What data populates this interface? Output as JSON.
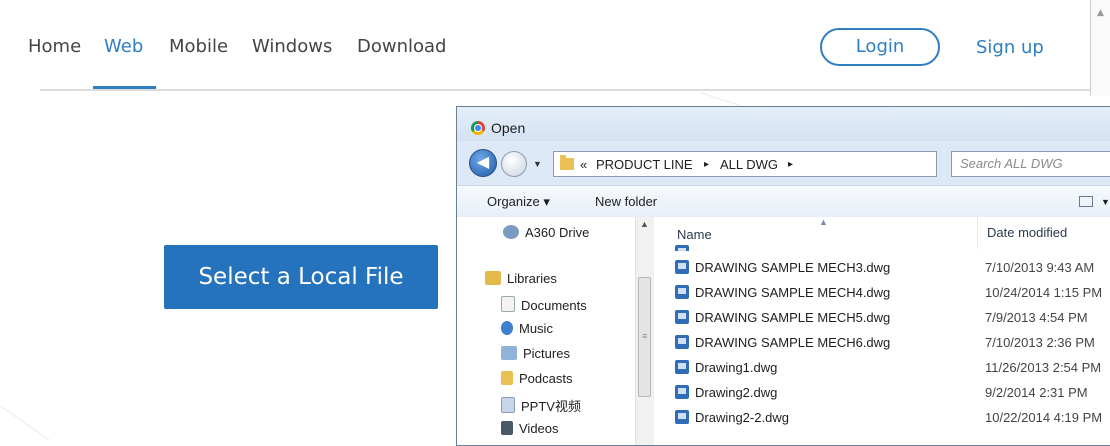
{
  "nav": {
    "items": [
      "Home",
      "Web",
      "Mobile",
      "Windows",
      "Download"
    ],
    "active": "Web",
    "login": "Login",
    "signup": "Sign up"
  },
  "main": {
    "select_button": "Select a Local File"
  },
  "dialog": {
    "title": "Open",
    "breadcrumb": [
      "«",
      "PRODUCT LINE",
      "▸",
      "ALL DWG",
      "▸"
    ],
    "search_placeholder": "Search ALL DWG",
    "toolbar": {
      "organize": "Organize ▾",
      "new_folder": "New folder"
    },
    "nav_pane": [
      {
        "label": "A360 Drive",
        "icon": "cloud-drive-icon"
      },
      {
        "label": "Libraries",
        "icon": "libraries-icon"
      },
      {
        "label": "Documents",
        "icon": "documents-icon"
      },
      {
        "label": "Music",
        "icon": "music-icon"
      },
      {
        "label": "Pictures",
        "icon": "pictures-icon"
      },
      {
        "label": "Podcasts",
        "icon": "podcasts-icon"
      },
      {
        "label": "PPTV视频",
        "icon": "pptv-icon"
      },
      {
        "label": "Videos",
        "icon": "videos-icon"
      }
    ],
    "columns": {
      "name": "Name",
      "date": "Date modified"
    },
    "files": [
      {
        "name": "DRAWING SAMPLE MECH3.dwg",
        "date": "7/10/2013 9:43 AM"
      },
      {
        "name": "DRAWING SAMPLE MECH4.dwg",
        "date": "10/24/2014 1:15 PM"
      },
      {
        "name": "DRAWING SAMPLE MECH5.dwg",
        "date": "7/9/2013 4:54 PM"
      },
      {
        "name": "DRAWING SAMPLE MECH6.dwg",
        "date": "7/10/2013 2:36 PM"
      },
      {
        "name": "Drawing1.dwg",
        "date": "11/26/2013 2:54 PM"
      },
      {
        "name": "Drawing2.dwg",
        "date": "9/2/2014 2:31 PM"
      },
      {
        "name": "Drawing2-2.dwg",
        "date": "10/22/2014 4:19 PM"
      }
    ]
  },
  "colors": {
    "accent": "#2f7ec4",
    "button": "#2573bd"
  }
}
